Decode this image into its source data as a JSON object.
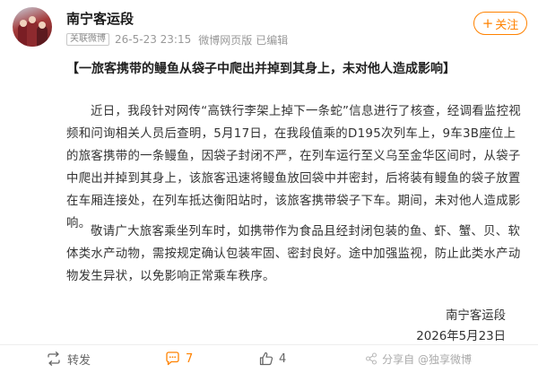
{
  "post": {
    "author": "南宁客运段",
    "badge": "关联微博",
    "time": "26-5-23 23:15",
    "source": "微博网页版",
    "edited": "已编辑",
    "follow_label": "关注",
    "title": "【一旅客携带的鳗鱼从袋子中爬出并掉到其身上，未对他人造成影响】",
    "paragraph1": "近日，我段针对网传“高铁行李架上掉下一条蛇”信息进行了核查，经调看监控视频和问询相关人员后查明，5月17日，在我段值乘的D195次列车上，9车3B座位上的旅客携带的一条鳗鱼，因袋子封闭不严，在列车运行至义乌至金华区间时，从袋子中爬出并掉到其身上，该旅客迅速将鳗鱼放回袋中并密封，后将装有鳗鱼的袋子放置在车厢连接处，在列车抵达衡阳站时，该旅客携带袋子下车。期间，未对他人造成影响。",
    "paragraph2": "敬请广大旅客乘坐列车时，如携带作为食品且经封闭包装的鱼、虾、蟹、贝、软体类水产动物，需按规定确认包装牢固、密封良好。途中加强监视，防止此类水产动物发生异状，以免影响正常乘车秩序。",
    "signature": "南宁客运段",
    "date": "2026年5月23日"
  },
  "actions": {
    "repost_label": "转发",
    "comment_count": "7",
    "like_count": "4",
    "share_text": "分享自 @独享微博",
    "accent_color": "#ff8200"
  }
}
